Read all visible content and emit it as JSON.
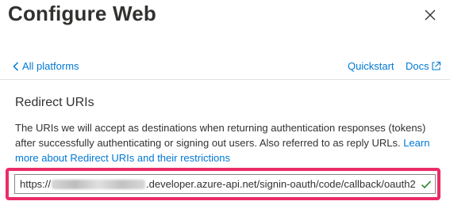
{
  "header": {
    "title": "Configure Web"
  },
  "nav": {
    "back_label": "All platforms",
    "quickstart_label": "Quickstart",
    "docs_label": "Docs"
  },
  "redirect": {
    "section_title": "Redirect URIs",
    "description_text": "The URIs we will accept as destinations when returning authentication responses (tokens) after successfully authenticating or signing out users. Also referred to as reply URLs. ",
    "description_link": "Learn more about Redirect URIs and their restrictions",
    "uri_prefix": "https://",
    "uri_suffix": ".developer.azure-api.net/signin-oauth/code/callback/oauth2",
    "uri_valid": true
  },
  "colors": {
    "link": "#0078d4",
    "highlight": "#ea2c67",
    "valid": "#107c10"
  }
}
